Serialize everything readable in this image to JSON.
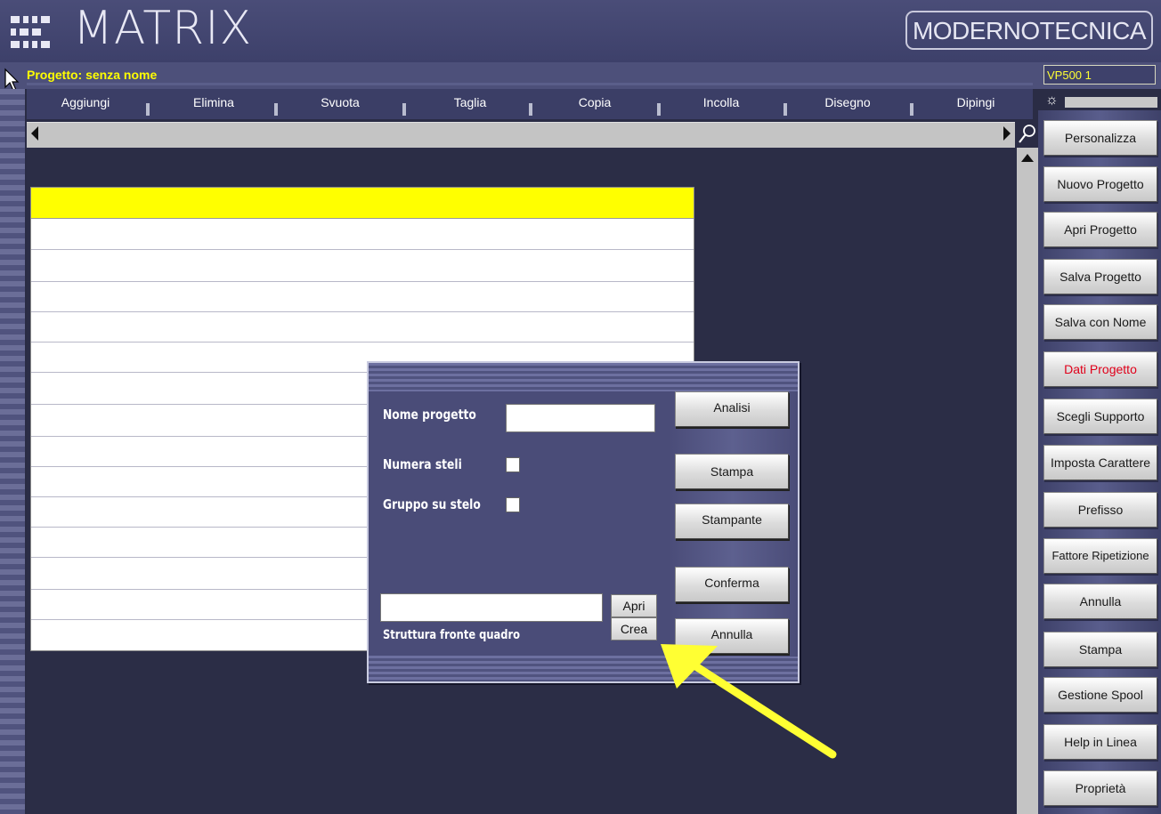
{
  "header": {
    "app_name": "MATRIX",
    "brand": "MODERNOTECNICA"
  },
  "project": {
    "title": "Progetto: senza nome",
    "code": "VP500 1"
  },
  "menu": {
    "items": [
      "Aggiungi",
      "Elimina",
      "Svuota",
      "Taglia",
      "Copia",
      "Incolla",
      "Disegno",
      "Dipingi"
    ]
  },
  "sidebar": {
    "buttons": [
      "Personalizza",
      "Nuovo Progetto",
      "Apri Progetto",
      "Salva Progetto",
      "Salva con Nome",
      "Dati Progetto",
      "Scegli Supporto",
      "Imposta Carattere",
      "Prefisso",
      "Fattore Ripetizione",
      "Annulla",
      "Stampa",
      "Gestione Spool",
      "Help in Linea",
      "Proprietà"
    ],
    "active_index": 5,
    "active_color": "#e0001a"
  },
  "dialog": {
    "nome_progetto_label": "Nome progetto",
    "nome_progetto_value": "",
    "numera_steli_label": "Numera steli",
    "numera_steli_checked": false,
    "gruppo_su_stelo_label": "Gruppo su stelo",
    "gruppo_su_stelo_checked": false,
    "struttura_label": "Struttura fronte quadro",
    "struttura_value": "",
    "apri_label": "Apri",
    "crea_label": "Crea",
    "buttons": {
      "analisi": "Analisi",
      "stampa": "Stampa",
      "stampante": "Stampante",
      "conferma": "Conferma",
      "annulla": "Annulla"
    }
  },
  "colors": {
    "header_bg": "#4a4d78",
    "project_title": "#ffff00",
    "sheet_header": "#ffff00",
    "annotation_arrow": "#ffff33"
  }
}
